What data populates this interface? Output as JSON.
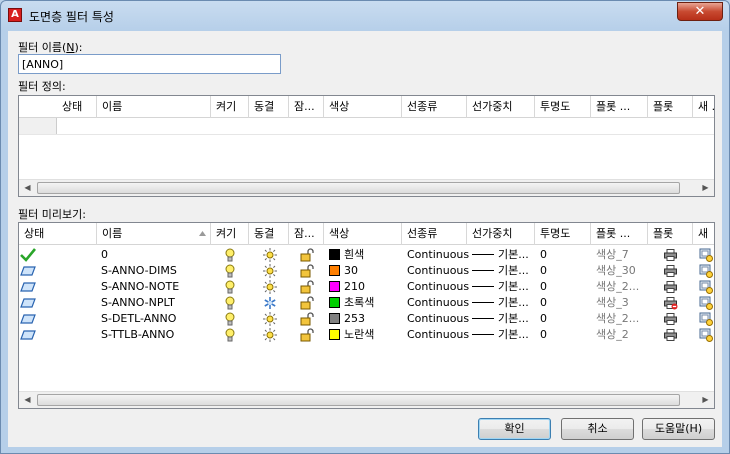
{
  "window": {
    "title": "도면층 필터 특성",
    "close_label": "✕"
  },
  "filter_name": {
    "label": "필터 이름(",
    "mnemonic": "N",
    "label_end": "):",
    "value": "[ANNO]"
  },
  "definition": {
    "label": "필터 정의:",
    "columns": [
      "상태",
      "이름",
      "켜기",
      "동결",
      "잠...",
      "색상",
      "선종류",
      "선가중치",
      "투명도",
      "플롯 ...",
      "플롯",
      "새 ..."
    ]
  },
  "preview": {
    "label": "필터 미리보기:",
    "columns": [
      "상태",
      "이름",
      "켜기",
      "동결",
      "잠...",
      "색상",
      "선종류",
      "선가중치",
      "투명도",
      "플롯 ...",
      "플롯",
      "새"
    ],
    "rows": [
      {
        "status": "current",
        "name": "0",
        "frozen": false,
        "color_hex": "#000000",
        "color_label": "흰색",
        "linetype": "Continuous",
        "lineweight": "기본...",
        "transparency": "0",
        "plot_style": "색상_7",
        "plot_enabled": true
      },
      {
        "status": "layer",
        "name": "S-ANNO-DIMS",
        "frozen": false,
        "color_hex": "#ff7f00",
        "color_label": "30",
        "linetype": "Continuous",
        "lineweight": "기본...",
        "transparency": "0",
        "plot_style": "색상_30",
        "plot_enabled": true
      },
      {
        "status": "layer",
        "name": "S-ANNO-NOTE",
        "frozen": false,
        "color_hex": "#ff00ff",
        "color_label": "210",
        "linetype": "Continuous",
        "lineweight": "기본...",
        "transparency": "0",
        "plot_style": "색상_2...",
        "plot_enabled": true
      },
      {
        "status": "layer",
        "name": "S-ANNO-NPLT",
        "frozen": true,
        "color_hex": "#00d000",
        "color_label": "초록색",
        "linetype": "Continuous",
        "lineweight": "기본...",
        "transparency": "0",
        "plot_style": "색상_3",
        "plot_enabled": false
      },
      {
        "status": "layer",
        "name": "S-DETL-ANNO",
        "frozen": false,
        "color_hex": "#808080",
        "color_label": "253",
        "linetype": "Continuous",
        "lineweight": "기본...",
        "transparency": "0",
        "plot_style": "색상_2...",
        "plot_enabled": true
      },
      {
        "status": "layer",
        "name": "S-TTLB-ANNO",
        "frozen": false,
        "color_hex": "#ffff00",
        "color_label": "노란색",
        "linetype": "Continuous",
        "lineweight": "기본...",
        "transparency": "0",
        "plot_style": "색상_2",
        "plot_enabled": true
      }
    ]
  },
  "buttons": {
    "ok": "확인",
    "cancel": "취소",
    "help": "도움말(H)"
  }
}
